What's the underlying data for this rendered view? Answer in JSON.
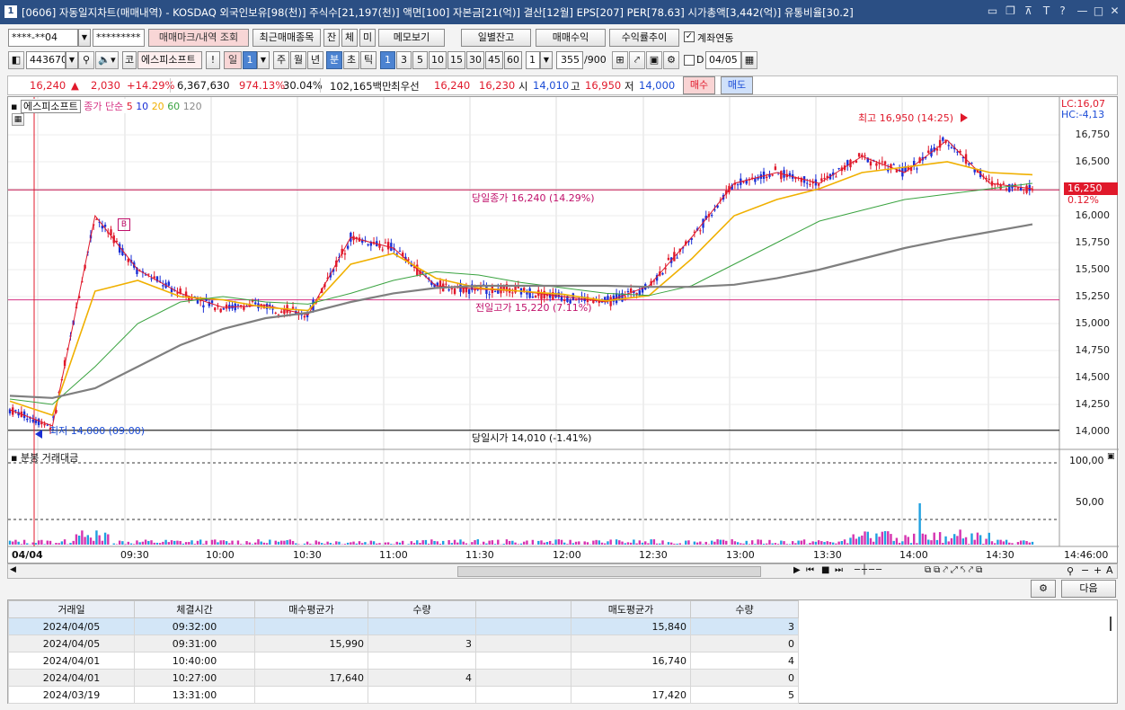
{
  "window": {
    "num": "1",
    "title": "[0606] 자동일지차트(매매내역) - KOSDAQ 외국인보유[98(천)] 주식수[21,197(천)] 액면[100] 자본금[21(억)] 결산[12월] EPS[207] PER[78.63] 시가총액[3,442(억)] 유통비율[30.2]",
    "controls": [
      "▭",
      "❐",
      "⊼",
      "T",
      "?",
      "—",
      "□",
      "✕"
    ]
  },
  "toolbar1": {
    "account": "****-**04",
    "password": "*********",
    "trade_mark_button": "매매마크/내역 조회",
    "recent_button": "최근매매종목",
    "jan": "잔",
    "che": "체",
    "mi": "미",
    "memo_button": "메모보기",
    "daily_balance_button": "일별잔고",
    "trade_profit_button": "매매수익",
    "return_trend_button": "수익률추이",
    "account_link_label": "계좌연동",
    "account_link_checked": true
  },
  "toolbar2": {
    "code": "443670",
    "prefix": "코",
    "stock_name": "에스피소프트",
    "excl": "!",
    "period_il": "일",
    "period_num": "1",
    "periods": [
      "주",
      "월",
      "년",
      "분",
      "초",
      "틱"
    ],
    "active_period": "분",
    "minute_options": [
      "1",
      "3",
      "5",
      "10",
      "15",
      "30",
      "45",
      "60"
    ],
    "active_minute": "1",
    "count_value": "1",
    "bars": "355",
    "bars_total": "/900",
    "d_label": "D",
    "date": "04/05"
  },
  "quote": {
    "price": "16,240",
    "up_arrow": "▲",
    "change": "2,030",
    "change_pct": "+14.29%",
    "volume": "6,367,630",
    "vol_ratio": "974.13%",
    "turnover": "30.04%",
    "amount": "102,165백만",
    "best_label": "최우선",
    "best_ask": "16,240",
    "best_bid": "16,230",
    "open_label": "시",
    "open": "14,010",
    "high_label": "고",
    "high": "16,950",
    "low_label": "저",
    "low": "14,000",
    "buy_button": "매수",
    "sell_button": "매도"
  },
  "chart": {
    "stock_tag": "에스피소프트",
    "ma_label": "종가 단순",
    "ma_periods": [
      "5",
      "10",
      "20",
      "60",
      "120"
    ],
    "ma_colors": [
      "#e0192b",
      "#1a2fd6",
      "#f0b000",
      "#3aa340",
      "#8a8a8a"
    ],
    "lc_label": "LC:16,07",
    "hc_label": "HC:-4,13",
    "current_price_tag": "16,250",
    "current_pct_tag": "0.12%",
    "annot_high": "최고 16,950 (14:25)",
    "annot_low": "최저 14,000 (09:00)",
    "annot_close": "당일종가 16,240 (14.29%)",
    "annot_prev_high": "전일고가 15,220 (7.11%)",
    "annot_open": "당일시가 14,010 (-1.41%)",
    "buy_marker": "B",
    "volume_label": "분봉 거래대금",
    "volume_ticks": [
      "100,00",
      "50,00"
    ],
    "y_ticks": [
      "16,750",
      "16,500",
      "16,250",
      "16,000",
      "15,750",
      "15,500",
      "15,250",
      "15,000",
      "14,750",
      "14,500",
      "14,250",
      "14,000"
    ],
    "x_ticks": [
      "04/04",
      "09:30",
      "10:00",
      "10:30",
      "11:00",
      "11:30",
      "12:00",
      "12:30",
      "13:00",
      "13:30",
      "14:00",
      "14:30",
      "14:46:00"
    ]
  },
  "chart_data": {
    "type": "candlestick",
    "title": "",
    "ylim": [
      13850,
      17000
    ],
    "timeline": [
      "09:00",
      "09:30",
      "10:00",
      "10:30",
      "11:00",
      "11:30",
      "12:00",
      "12:30",
      "13:00",
      "13:30",
      "14:00",
      "14:30"
    ],
    "reference_lines": [
      {
        "label": "당일종가",
        "value": 16240
      },
      {
        "label": "전일고가",
        "value": 15220
      },
      {
        "label": "당일시가",
        "value": 14010
      }
    ],
    "series": [
      {
        "name": "종가 단순 5",
        "values": [
          14200,
          14050,
          16000,
          15500,
          15280,
          15150,
          15170,
          15080,
          15800,
          15700,
          15350,
          15320,
          15300,
          15250,
          15200,
          15350,
          15800,
          16300,
          16400,
          16300,
          16550,
          16400,
          16700,
          16300,
          16250
        ]
      },
      {
        "name": "종가 단순 20",
        "values": [
          14280,
          14150,
          15300,
          15400,
          15250,
          15220,
          15150,
          15120,
          15550,
          15650,
          15420,
          15330,
          15300,
          15270,
          15210,
          15260,
          15600,
          16000,
          16150,
          16250,
          16400,
          16450,
          16500,
          16400,
          16380
        ]
      },
      {
        "name": "종가 단순 60",
        "values": [
          14300,
          14250,
          14600,
          15000,
          15200,
          15250,
          15200,
          15180,
          15280,
          15400,
          15480,
          15450,
          15380,
          15330,
          15280,
          15260,
          15350,
          15550,
          15750,
          15950,
          16050,
          16150,
          16200,
          16250,
          16300
        ]
      },
      {
        "name": "종가 단순 120",
        "values": [
          14330,
          14310,
          14400,
          14600,
          14800,
          14950,
          15050,
          15100,
          15200,
          15280,
          15330,
          15350,
          15350,
          15350,
          15350,
          15340,
          15340,
          15360,
          15420,
          15500,
          15600,
          15700,
          15780,
          15850,
          15920
        ]
      }
    ]
  },
  "nav": {
    "next_button": "다음"
  },
  "trades": {
    "headers": [
      "거래일",
      "체결시간",
      "매수평균가",
      "수량",
      "",
      "매도평균가",
      "수량"
    ],
    "rows": [
      [
        "2024/04/05",
        "09:32:00",
        "",
        "",
        "",
        "15,840",
        "3"
      ],
      [
        "2024/04/05",
        "09:31:00",
        "15,990",
        "3",
        "",
        "",
        "0"
      ],
      [
        "2024/04/01",
        "10:40:00",
        "",
        "",
        "",
        "16,740",
        "4"
      ],
      [
        "2024/04/01",
        "10:27:00",
        "17,640",
        "4",
        "",
        "",
        "0"
      ],
      [
        "2024/03/19",
        "13:31:00",
        "",
        "",
        "",
        "17,420",
        "5"
      ]
    ]
  }
}
